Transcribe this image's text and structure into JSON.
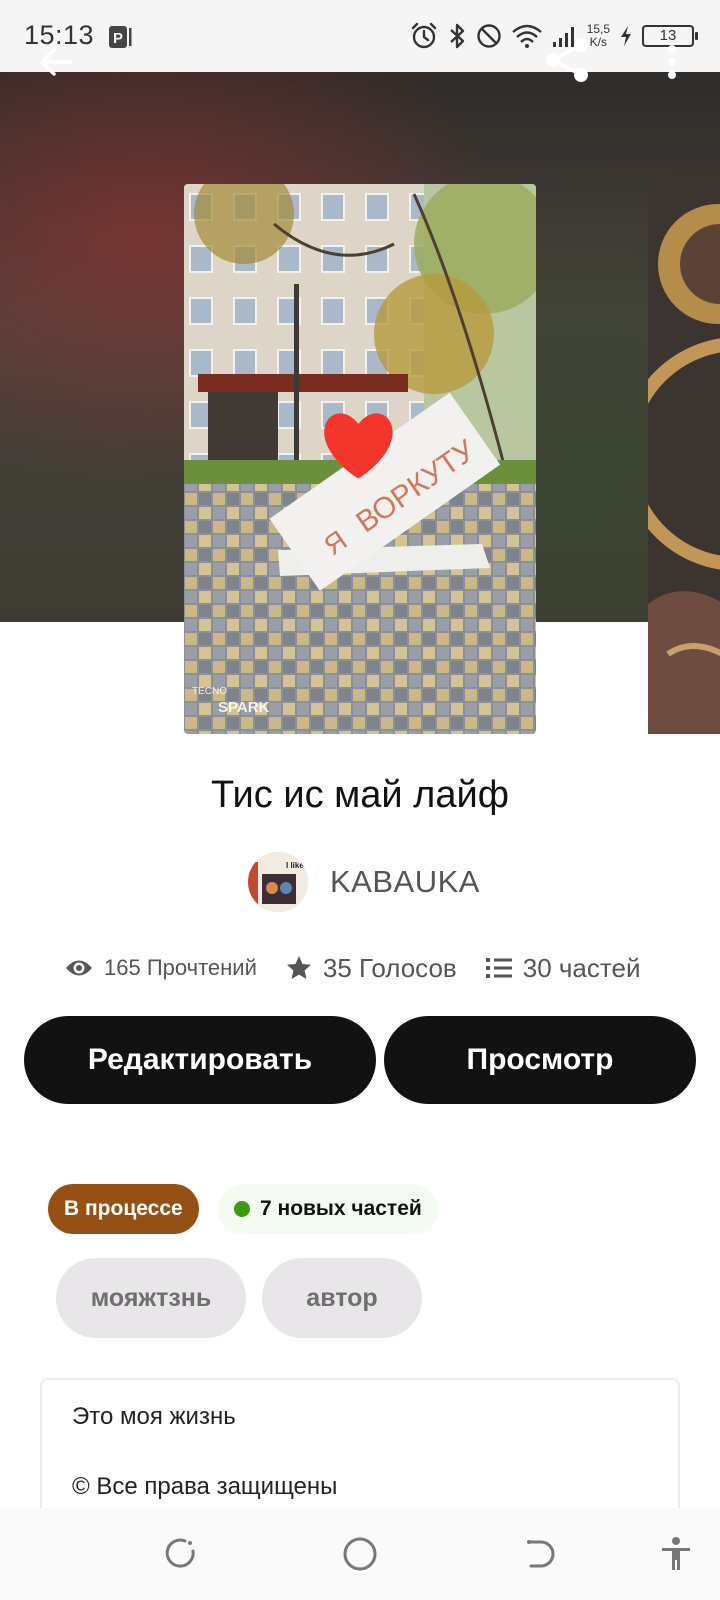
{
  "status_bar": {
    "time": "15:13",
    "net_speed_value": "15,5",
    "net_speed_unit": "K/s",
    "battery": "13"
  },
  "toolbar": {
    "back_icon": "arrow-left-icon",
    "share_icon": "share-icon",
    "more_icon": "more-vertical-icon"
  },
  "cover": {
    "sign_heart_text": "Я",
    "sign_city_text": "ВОРКУТУ",
    "watermark_brand": "TECNO",
    "watermark_model": "SPARK"
  },
  "story": {
    "title": "Тис ис май лайф",
    "author": "KABAUKA",
    "avatar_text": "I like"
  },
  "stats": {
    "reads": "165 Прочтений",
    "votes": "35 Голосов",
    "parts": "30 частей"
  },
  "actions": {
    "edit": "Редактировать",
    "view": "Просмотр"
  },
  "badges": {
    "status": "В процессе",
    "new_parts": "7 новых частей"
  },
  "tags": [
    "мояжтзнь",
    "автор"
  ],
  "description": {
    "line1": "Это моя жизнь",
    "line2": "© Все права защищены"
  },
  "colors": {
    "primary_button": "#121212",
    "status_badge": "#955115",
    "new_parts_dot": "#3b9a0d",
    "tag_bg": "#e8e6e8"
  }
}
